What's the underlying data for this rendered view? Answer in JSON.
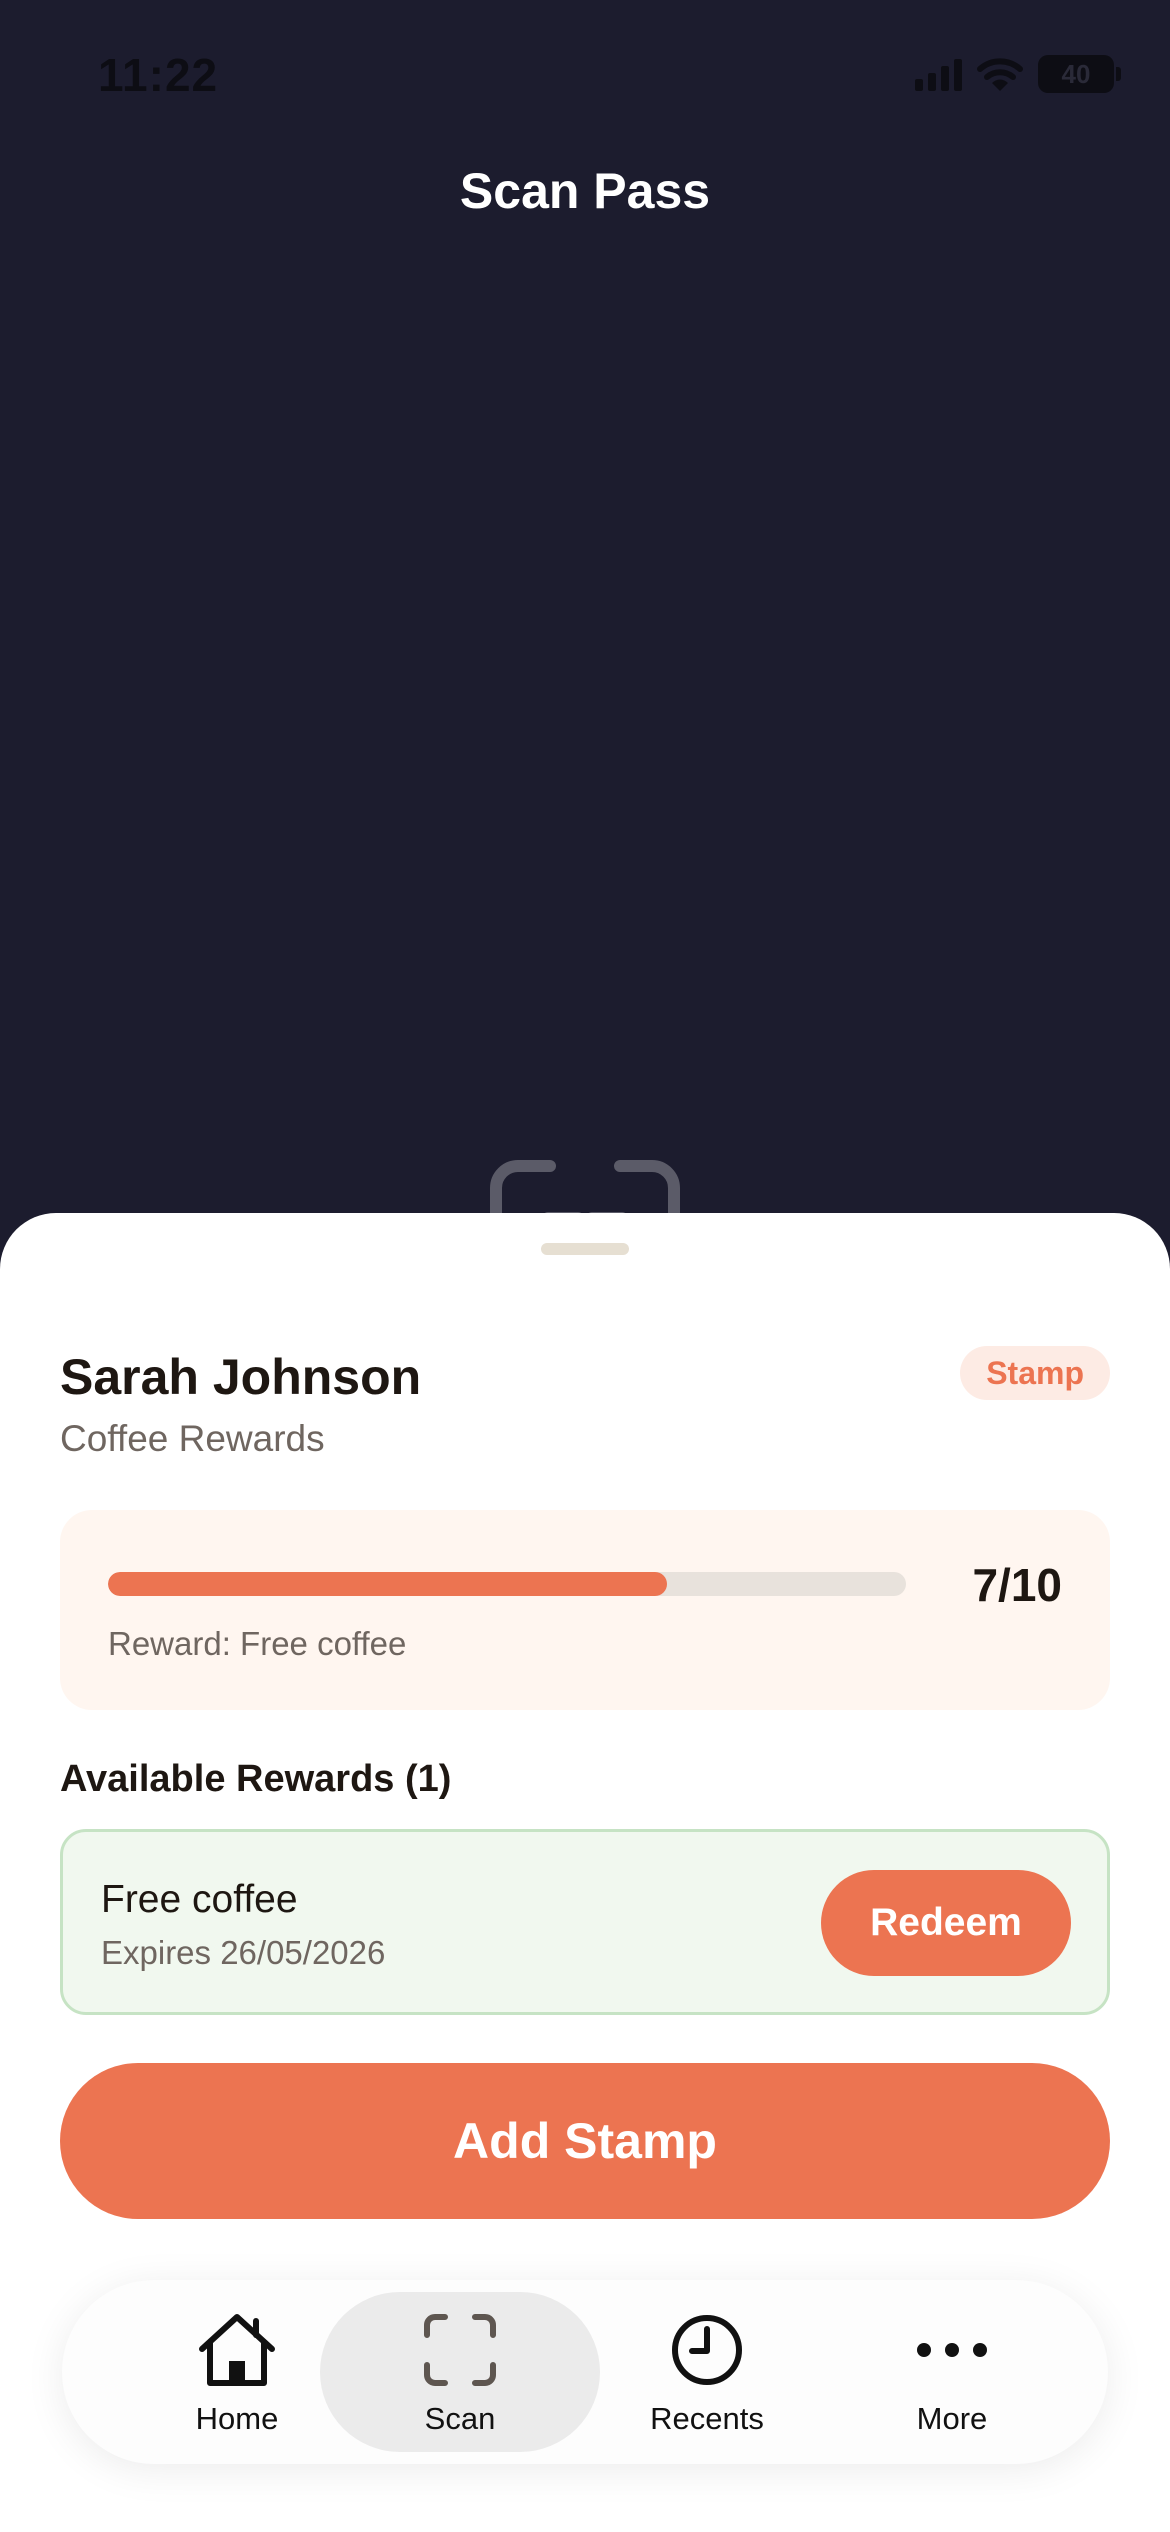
{
  "status_bar": {
    "time": "11:22",
    "battery_level": "40",
    "icons": [
      "cellular-signal-icon",
      "wifi-icon",
      "battery-icon"
    ]
  },
  "screen": {
    "title": "Scan Pass",
    "scanner_icon": "scan-frame-icon",
    "background_color": "#1c1c2e"
  },
  "customer": {
    "name": "Sarah Johnson",
    "program": "Coffee Rewards",
    "badge": "Stamp"
  },
  "progress": {
    "current": 7,
    "total": 10,
    "count_label": "7/10",
    "reward_label": "Reward: Free coffee"
  },
  "rewards": {
    "heading": "Available Rewards (1)",
    "items": [
      {
        "title": "Free coffee",
        "expiry": "Expires 26/05/2026",
        "action_label": "Redeem"
      }
    ]
  },
  "actions": {
    "add_stamp_label": "Add Stamp"
  },
  "tab_bar": {
    "active": "Scan",
    "tabs": [
      {
        "label": "Home",
        "icon": "house-icon"
      },
      {
        "label": "Scan",
        "icon": "scan-frame-icon"
      },
      {
        "label": "Recents",
        "icon": "clock-icon"
      },
      {
        "label": "More",
        "icon": "ellipsis-icon"
      }
    ]
  },
  "colors": {
    "accent": "#ec7451",
    "badge_background": "#fdebe4",
    "progress_card_background": "#fff6f0",
    "reward_card_background": "#f1f8ef",
    "reward_card_border": "#c6e3c4"
  }
}
